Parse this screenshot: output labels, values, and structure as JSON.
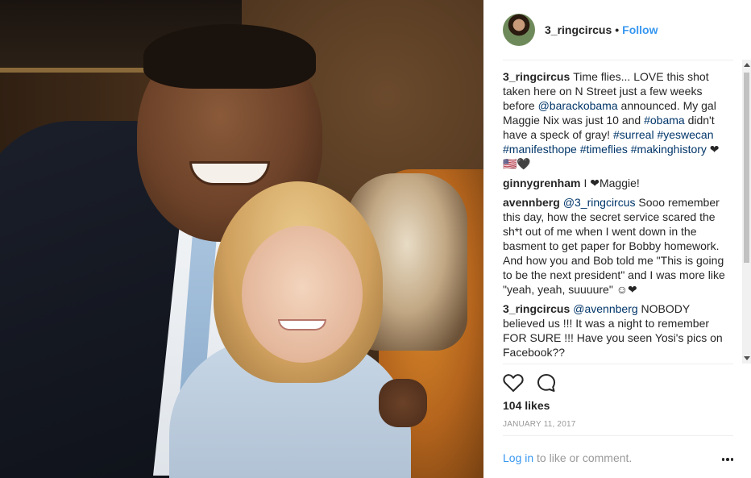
{
  "post": {
    "username": "3_ringcircus",
    "separator": "•",
    "follow_label": "Follow",
    "likes": "104 likes",
    "date": "JANUARY 11, 2017"
  },
  "comments": [
    {
      "user": "3_ringcircus",
      "parts": [
        {
          "text": "Time flies... LOVE this shot taken here on N Street just a few weeks before ",
          "link": false
        },
        {
          "text": "@barackobama",
          "link": true
        },
        {
          "text": " announced. My gal Maggie Nix was just 10 and ",
          "link": false
        },
        {
          "text": "#obama",
          "link": true
        },
        {
          "text": " didn't have a speck of gray! ",
          "link": false
        },
        {
          "text": "#surreal",
          "link": true
        },
        {
          "text": " ",
          "link": false
        },
        {
          "text": "#yeswecan",
          "link": true
        },
        {
          "text": " ",
          "link": false
        },
        {
          "text": "#manifesthope",
          "link": true
        },
        {
          "text": " ",
          "link": false
        },
        {
          "text": "#timeflies",
          "link": true
        },
        {
          "text": " ",
          "link": false
        },
        {
          "text": "#makinghistory",
          "link": true
        },
        {
          "text": " ❤🇺🇸🖤",
          "link": false
        }
      ]
    },
    {
      "user": "ginnygrenham",
      "parts": [
        {
          "text": "I ❤Maggie!",
          "link": false
        }
      ]
    },
    {
      "user": "avennberg",
      "parts": [
        {
          "text": "@3_ringcircus",
          "link": true
        },
        {
          "text": " Sooo remember this day, how the secret service scared the sh*t out of me when I went down in the basment to get paper for Bobby homework. And how you and Bob told me \"This is going to be the next president\" and I was more like \"yeah, yeah, suuuure\" ☺❤",
          "link": false
        }
      ]
    },
    {
      "user": "3_ringcircus",
      "parts": [
        {
          "text": "@avennberg",
          "link": true
        },
        {
          "text": " NOBODY believed us !!! It was a night to remember FOR SURE !!! Have you seen Yosi's pics on Facebook??",
          "link": false
        }
      ]
    }
  ],
  "footer": {
    "login_link": "Log in",
    "login_rest": " to like or comment."
  },
  "icons": {
    "like": "heart-icon",
    "comment": "comment-bubble-icon",
    "more": "more-options-icon"
  },
  "colors": {
    "link_blue": "#3897f0",
    "mention_dark": "#003569",
    "text": "#262626",
    "muted": "#999999"
  }
}
